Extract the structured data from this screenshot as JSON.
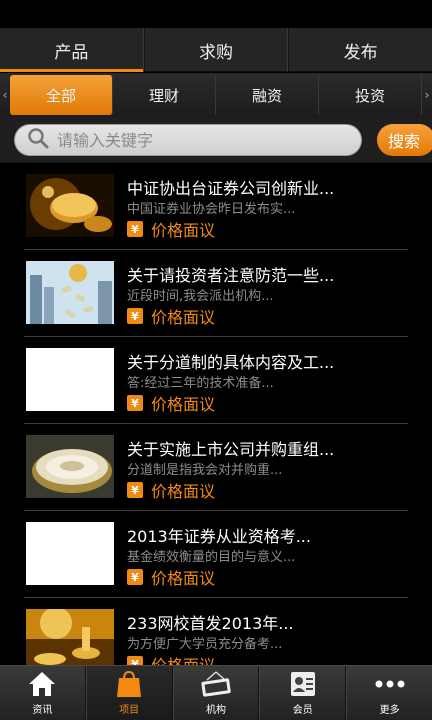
{
  "top_tabs": [
    {
      "label": "产品",
      "active": true
    },
    {
      "label": "求购",
      "active": false
    },
    {
      "label": "发布",
      "active": false
    }
  ],
  "categories": [
    {
      "label": "全部",
      "active": true
    },
    {
      "label": "理财",
      "active": false
    },
    {
      "label": "融资",
      "active": false
    },
    {
      "label": "投资",
      "active": false
    }
  ],
  "search": {
    "placeholder": "请输入关键字",
    "button_label": "搜索"
  },
  "items": [
    {
      "title": "中证协出台证券公司创新业...",
      "desc": "中国证券业协会昨日发布实...",
      "price": "价格面议",
      "thumb": "gold-coins-image"
    },
    {
      "title": "关于请投资者注意防范一些...",
      "desc": "近段时间,我会派出机构...",
      "price": "价格面议",
      "thumb": "money-city-image"
    },
    {
      "title": "关于分道制的具体内容及工...",
      "desc": "答:经过三年的技术准备...",
      "price": "价格面议",
      "thumb": "blank-image"
    },
    {
      "title": "关于实施上市公司并购重组...",
      "desc": "分道制是指我会对并购重...",
      "price": "价格面议",
      "thumb": "coin-closeup-image"
    },
    {
      "title": "2013年证券从业资格考...",
      "desc": "基金绩效衡量的目的与意义...",
      "price": "价格面议",
      "thumb": "blank-image"
    },
    {
      "title": "233网校首发2013年...",
      "desc": "为方便广大学员充分备考...",
      "price": "价格面议",
      "thumb": "gold-hourglass-image"
    }
  ],
  "yen_symbol": "¥",
  "bottom_nav": [
    {
      "label": "资讯",
      "icon": "home-icon",
      "active": false
    },
    {
      "label": "项目",
      "icon": "shopping-bag-icon",
      "active": true
    },
    {
      "label": "机构",
      "icon": "open-sign-icon",
      "active": false
    },
    {
      "label": "会员",
      "icon": "member-card-icon",
      "active": false
    },
    {
      "label": "更多",
      "icon": "more-dots-icon",
      "active": false
    }
  ],
  "colors": {
    "accent": "#ef8a14",
    "background": "#000000",
    "bar": "#252525"
  }
}
